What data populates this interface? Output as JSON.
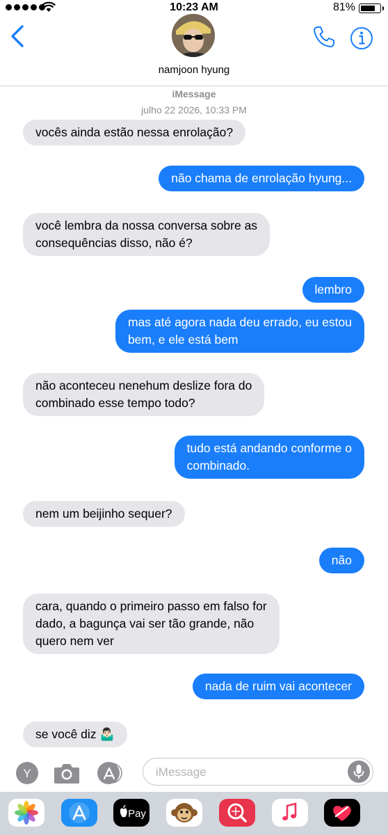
{
  "status": {
    "time": "10:23 AM",
    "battery": "81%"
  },
  "header": {
    "contact_name": "namjoon hyung"
  },
  "thread": {
    "service": "iMessage",
    "timestamp": "julho 22 2026, 10:33 PM"
  },
  "messages": [
    {
      "from": "them",
      "text": "vocês ainda estão nessa enrolação?"
    },
    {
      "from": "me",
      "text": "não chama de enrolação hyung..."
    },
    {
      "from": "them",
      "lines": [
        "você lembra da nossa conversa sobre as",
        "consequências disso, não é?"
      ]
    },
    {
      "from": "me",
      "text": "lembro"
    },
    {
      "from": "me",
      "lines": [
        "mas até agora nada deu errado, eu estou",
        "bem, e ele está bem"
      ]
    },
    {
      "from": "them",
      "lines": [
        "não aconteceu nenehum deslize fora do",
        "combinado esse tempo todo?"
      ]
    },
    {
      "from": "me",
      "lines": [
        "tudo está andando conforme o",
        "combinado."
      ]
    },
    {
      "from": "them",
      "text": "nem um beijinho sequer?"
    },
    {
      "from": "me",
      "text": "não"
    },
    {
      "from": "them",
      "lines": [
        "cara, quando o primeiro passo em falso for",
        "dado, a bagunça vai ser tão grande, não",
        "quero nem ver"
      ]
    },
    {
      "from": "me",
      "text": "nada de ruim vai acontecer"
    },
    {
      "from": "them",
      "text": "se você diz 🤷🏻‍♂️"
    }
  ],
  "composer": {
    "placeholder": "iMessage",
    "apps_button_label": "Y"
  },
  "app_drawer": [
    {
      "name": "photos-app-icon"
    },
    {
      "name": "app-store-icon"
    },
    {
      "name": "apple-pay-icon",
      "label": "Pay"
    },
    {
      "name": "animoji-monkey-icon"
    },
    {
      "name": "image-search-icon"
    },
    {
      "name": "music-icon"
    },
    {
      "name": "digital-touch-icon"
    }
  ]
}
